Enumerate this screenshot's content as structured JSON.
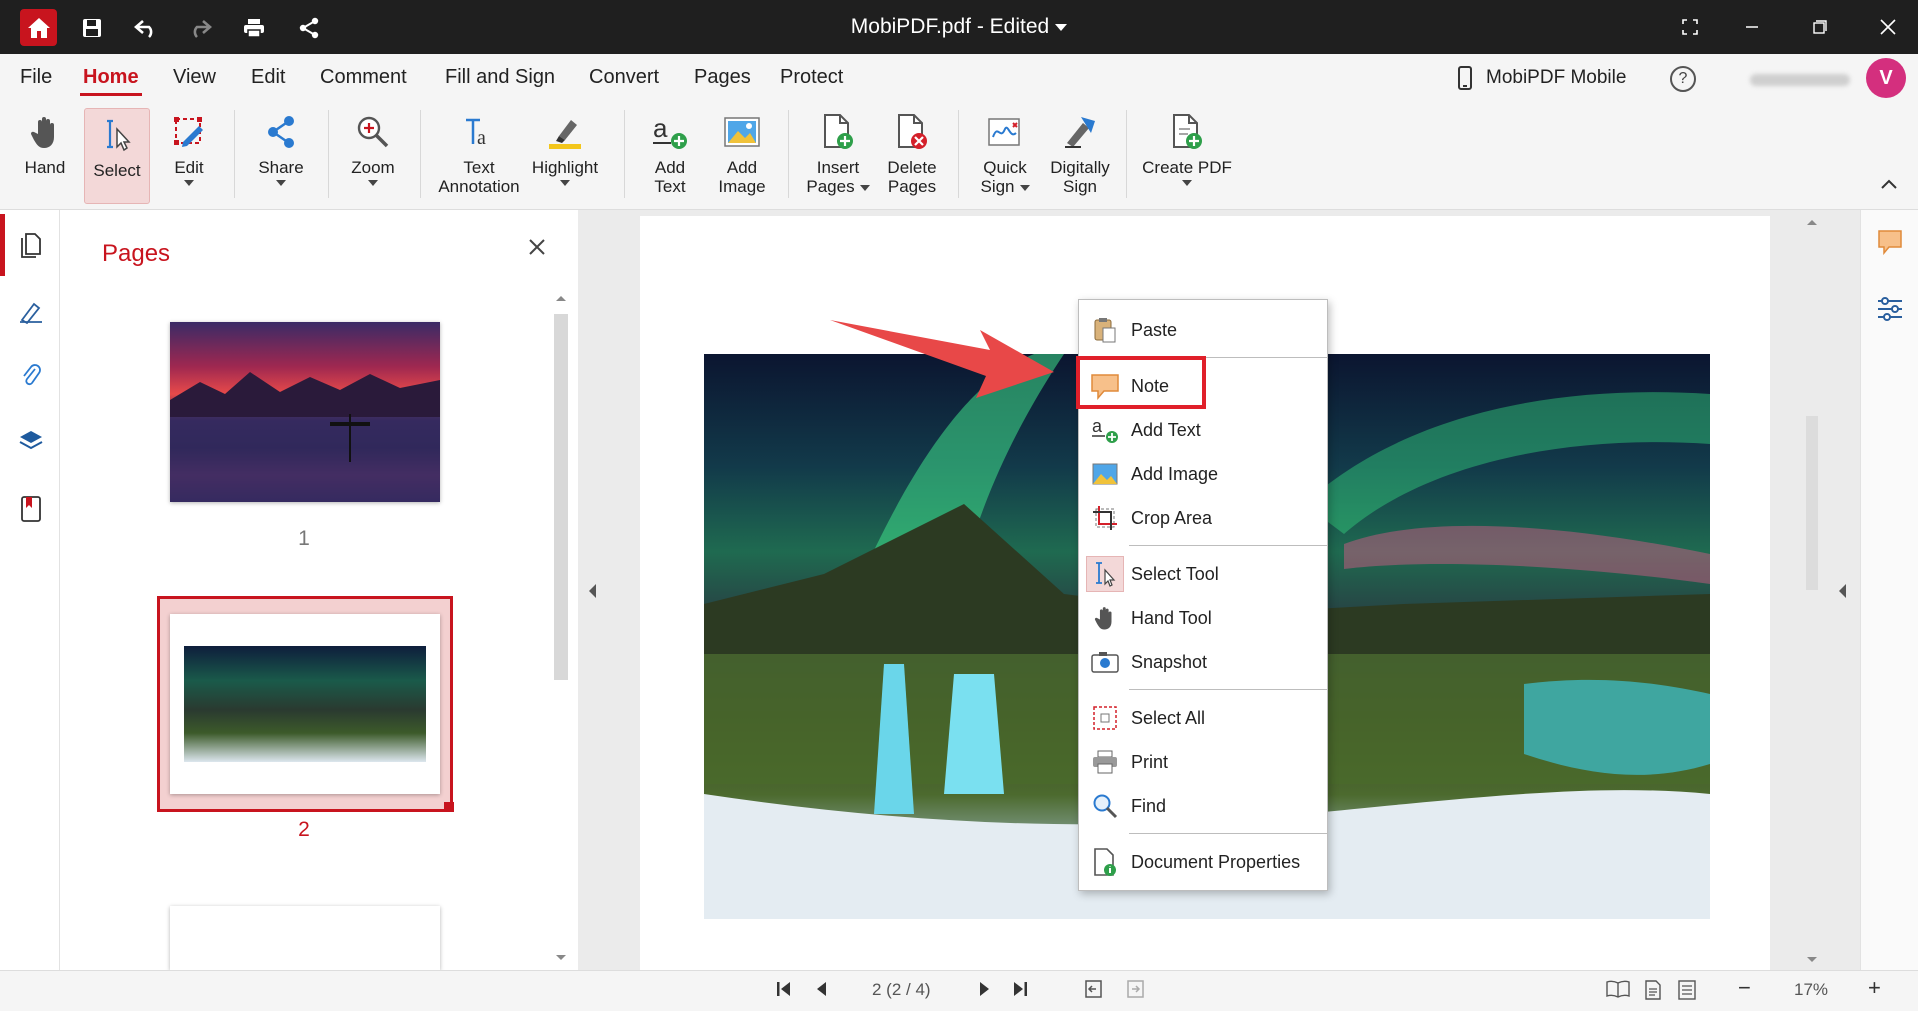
{
  "window": {
    "title": "MobiPDF.pdf - Edited"
  },
  "menu": {
    "items": [
      "File",
      "Home",
      "View",
      "Edit",
      "Comment",
      "Fill and Sign",
      "Convert",
      "Pages",
      "Protect"
    ],
    "active": "Home",
    "mobile_label": "MobiPDF Mobile",
    "help_label": "?",
    "avatar_initial": "V"
  },
  "ribbon": {
    "hand": "Hand",
    "select": "Select",
    "edit": "Edit",
    "share": "Share",
    "zoom": "Zoom",
    "text_annotation_1": "Text",
    "text_annotation_2": "Annotation",
    "highlight": "Highlight",
    "add_text_1": "Add",
    "add_text_2": "Text",
    "add_image_1": "Add",
    "add_image_2": "Image",
    "insert_pages_1": "Insert",
    "insert_pages_2": "Pages",
    "delete_pages_1": "Delete",
    "delete_pages_2": "Pages",
    "quick_sign_1": "Quick",
    "quick_sign_2": "Sign",
    "digitally_sign_1": "Digitally",
    "digitally_sign_2": "Sign",
    "create_pdf": "Create PDF"
  },
  "pages_panel": {
    "title": "Pages",
    "page1": "1",
    "page2": "2"
  },
  "context_menu": {
    "paste": "Paste",
    "note": "Note",
    "add_text": "Add Text",
    "add_image": "Add Image",
    "crop_area": "Crop Area",
    "select_tool": "Select Tool",
    "hand_tool": "Hand Tool",
    "snapshot": "Snapshot",
    "select_all": "Select All",
    "print": "Print",
    "find": "Find",
    "document_properties": "Document Properties"
  },
  "status": {
    "page_indicator": "2 (2 / 4)",
    "zoom": "17%",
    "zoom_out": "−",
    "zoom_in": "+"
  },
  "colors": {
    "accent": "#c8141e",
    "titlebar": "#1f1f1f",
    "note_icon": "#f5a55a"
  }
}
